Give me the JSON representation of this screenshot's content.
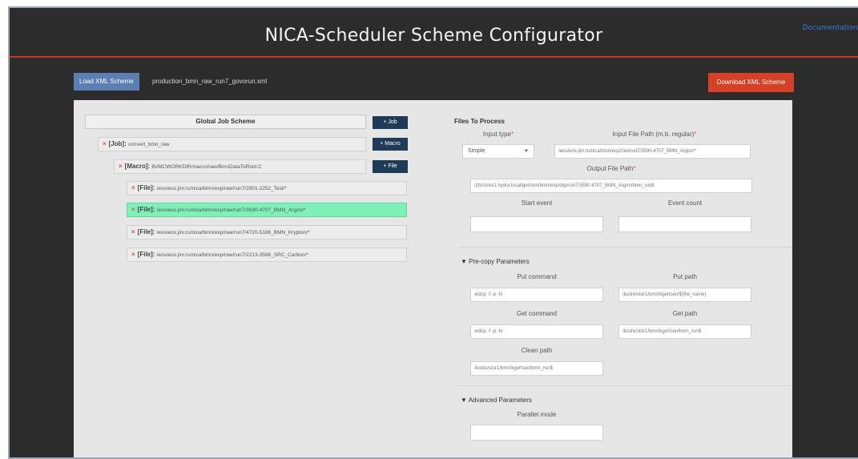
{
  "header": {
    "title": "NICA-Scheduler Scheme Configurator",
    "documentation_link": "Documentation"
  },
  "toolbar": {
    "load_label": "Load XML Scheme",
    "file_name": "production_bmn_raw_run7_govorun.xml",
    "download_label": "Download XML Scheme"
  },
  "tree": {
    "header": "Global Job Scheme",
    "add_job": "+ Job",
    "add_macro": "+ Macro",
    "add_file": "+ File",
    "remove_glyph": "×",
    "job": {
      "kind": "[Job]:",
      "name": "convert_bmn_raw"
    },
    "macro": {
      "kind": "[Macro]:",
      "path": "$VMCWORKDIR/macro/raw/BmnDataToRoot.C"
    },
    "files": [
      {
        "kind": "[File]:",
        "path": "/eos/eos.jinr.ru/nica/bmn/exp/raw/run7/2901-2252_Tesl/*",
        "selected": false
      },
      {
        "kind": "[File]:",
        "path": "/eos/eos.jinr.ru/nica/bmn/exp/raw/run7/3590-4707_BMN_Argon/*",
        "selected": true
      },
      {
        "kind": "[File]:",
        "path": "/eos/eos.jinr.ru/nica/bmn/exp/raw/run7/4720-5186_BMN_Krypton/*",
        "selected": false
      },
      {
        "kind": "[File]:",
        "path": "/eos/eos.jinr.ru/nica/bmn/exp/raw/run7/2213-3588_SRC_Carbon/*",
        "selected": false
      }
    ]
  },
  "files_to_process": {
    "title": "Files To Process",
    "input_type_label": "Input type",
    "input_type_value": "Simple",
    "input_path_label": "Input File Path (m.b. regular)",
    "input_path_value": "/eos/eos.jinr.ru/nica/bmn/exp/raw/run7/3590-4707_BMN_Argon/*",
    "output_path_label": "Output File Path",
    "output_path_value": "/zfs/store1.hydra.local/gertsen/bmn/exp/digi/run7/3590-4707_BMN_Argon/bmn_run$",
    "start_event_label": "Start event",
    "start_event_value": "",
    "event_count_label": "Event count",
    "event_count_value": "",
    "required_mark": "*",
    "select_caret": "▼"
  },
  "precopy": {
    "title": "▼ Pre-copy Parameters",
    "put_command_label": "Put command",
    "put_command_value": "xrdcp -f -p -N",
    "put_path_label": "Put path",
    "put_path_value": "/lustre/stor1/bmn/kgertsen/${file_name}",
    "get_command_label": "Get command",
    "get_command_value": "xrdcp -f -p -N",
    "get_path_label": "Get path",
    "get_path_value": "/lustre/stor1/bmn/kgertsen/bmn_run$",
    "clean_path_label": "Clean path",
    "clean_path_value": "/lustre/stor1/bmn/kgertsen/bmn_run$"
  },
  "advanced": {
    "title": "▼ Advanced Parameters",
    "parallel_mode_label": "Parallel mode",
    "parallel_mode_value": ""
  },
  "colors": {
    "background": "#2c2c2c",
    "accent_red": "#c0392b",
    "download_button": "#d64027",
    "load_button": "#5b7fb3",
    "tree_button": "#1f3b57",
    "selected_node": "#7ff0b8",
    "link": "#3a7bd5"
  }
}
